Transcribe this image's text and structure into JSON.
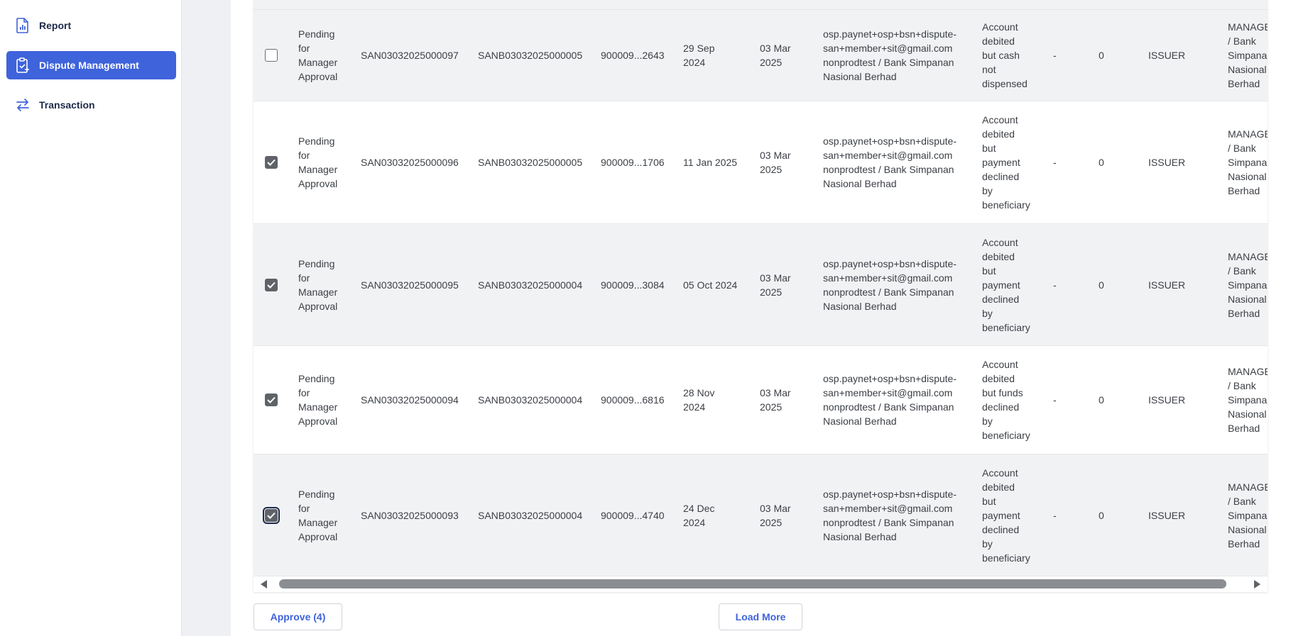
{
  "sidebar": {
    "items": [
      {
        "label": "Report",
        "icon": "report-icon",
        "active": false
      },
      {
        "label": "Dispute Management",
        "icon": "clipboard-icon",
        "active": true
      },
      {
        "label": "Transaction",
        "icon": "transfer-arrows-icon",
        "active": false
      }
    ]
  },
  "colors": {
    "accent": "#3f63db",
    "row_alt": "#f1f2f4",
    "checkbox_checked": "#5f6368"
  },
  "table": {
    "rows": [
      {
        "checked": false,
        "status": [
          "Pending",
          "for",
          "Manager",
          "Approval"
        ],
        "case_id": "SAN03032025000097",
        "batch_id": "SANB03032025000005",
        "account": "900009...2643",
        "txn_date": [
          "29 Sep",
          "2024"
        ],
        "created_date": [
          "03 Mar",
          "2025"
        ],
        "created_by": [
          "osp.paynet+osp+bsn+dispute-",
          "san+member+sit@gmail.com",
          "nonprodtest / Bank Simpanan",
          "Nasional Berhad"
        ],
        "reason": [
          "Account",
          "debited",
          "but cash",
          "not",
          "dispensed"
        ],
        "col_dash": "-",
        "col_zero": "0",
        "role": "ISSUER",
        "assignee": [
          "MANAGE",
          "/ Bank",
          "Simpanan",
          "Nasional",
          "Berhad"
        ]
      },
      {
        "checked": true,
        "status": [
          "Pending",
          "for",
          "Manager",
          "Approval"
        ],
        "case_id": "SAN03032025000096",
        "batch_id": "SANB03032025000005",
        "account": "900009...1706",
        "txn_date": [
          "11 Jan 2025"
        ],
        "created_date": [
          "03 Mar",
          "2025"
        ],
        "created_by": [
          "osp.paynet+osp+bsn+dispute-",
          "san+member+sit@gmail.com",
          "nonprodtest / Bank Simpanan",
          "Nasional Berhad"
        ],
        "reason": [
          "Account",
          "debited",
          "but",
          "payment",
          "declined",
          "by",
          "beneficiary"
        ],
        "col_dash": "-",
        "col_zero": "0",
        "role": "ISSUER",
        "assignee": [
          "MANAGE",
          "/ Bank",
          "Simpanan",
          "Nasional",
          "Berhad"
        ]
      },
      {
        "checked": true,
        "status": [
          "Pending",
          "for",
          "Manager",
          "Approval"
        ],
        "case_id": "SAN03032025000095",
        "batch_id": "SANB03032025000004",
        "account": "900009...3084",
        "txn_date": [
          "05 Oct 2024"
        ],
        "created_date": [
          "03 Mar",
          "2025"
        ],
        "created_by": [
          "osp.paynet+osp+bsn+dispute-",
          "san+member+sit@gmail.com",
          "nonprodtest / Bank Simpanan",
          "Nasional Berhad"
        ],
        "reason": [
          "Account",
          "debited",
          "but",
          "payment",
          "declined",
          "by",
          "beneficiary"
        ],
        "col_dash": "-",
        "col_zero": "0",
        "role": "ISSUER",
        "assignee": [
          "MANAGE",
          "/ Bank",
          "Simpanan",
          "Nasional",
          "Berhad"
        ]
      },
      {
        "checked": true,
        "status": [
          "Pending",
          "for",
          "Manager",
          "Approval"
        ],
        "case_id": "SAN03032025000094",
        "batch_id": "SANB03032025000004",
        "account": "900009...6816",
        "txn_date": [
          "28 Nov",
          "2024"
        ],
        "created_date": [
          "03 Mar",
          "2025"
        ],
        "created_by": [
          "osp.paynet+osp+bsn+dispute-",
          "san+member+sit@gmail.com",
          "nonprodtest / Bank Simpanan",
          "Nasional Berhad"
        ],
        "reason": [
          "Account",
          "debited",
          "but funds",
          "declined",
          "by",
          "beneficiary"
        ],
        "col_dash": "-",
        "col_zero": "0",
        "role": "ISSUER",
        "assignee": [
          "MANAGE",
          "/ Bank",
          "Simpanan",
          "Nasional",
          "Berhad"
        ]
      },
      {
        "checked": true,
        "focused": true,
        "status": [
          "Pending",
          "for",
          "Manager",
          "Approval"
        ],
        "case_id": "SAN03032025000093",
        "batch_id": "SANB03032025000004",
        "account": "900009...4740",
        "txn_date": [
          "24 Dec",
          "2024"
        ],
        "created_date": [
          "03 Mar",
          "2025"
        ],
        "created_by": [
          "osp.paynet+osp+bsn+dispute-",
          "san+member+sit@gmail.com",
          "nonprodtest / Bank Simpanan",
          "Nasional Berhad"
        ],
        "reason": [
          "Account",
          "debited",
          "but",
          "payment",
          "declined",
          "by",
          "beneficiary"
        ],
        "col_dash": "-",
        "col_zero": "0",
        "role": "ISSUER",
        "assignee": [
          "MANAGE",
          "/ Bank",
          "Simpanan",
          "Nasional",
          "Berhad"
        ]
      }
    ]
  },
  "actions": {
    "approve_label": "Approve (4)",
    "load_more_label": "Load More"
  }
}
